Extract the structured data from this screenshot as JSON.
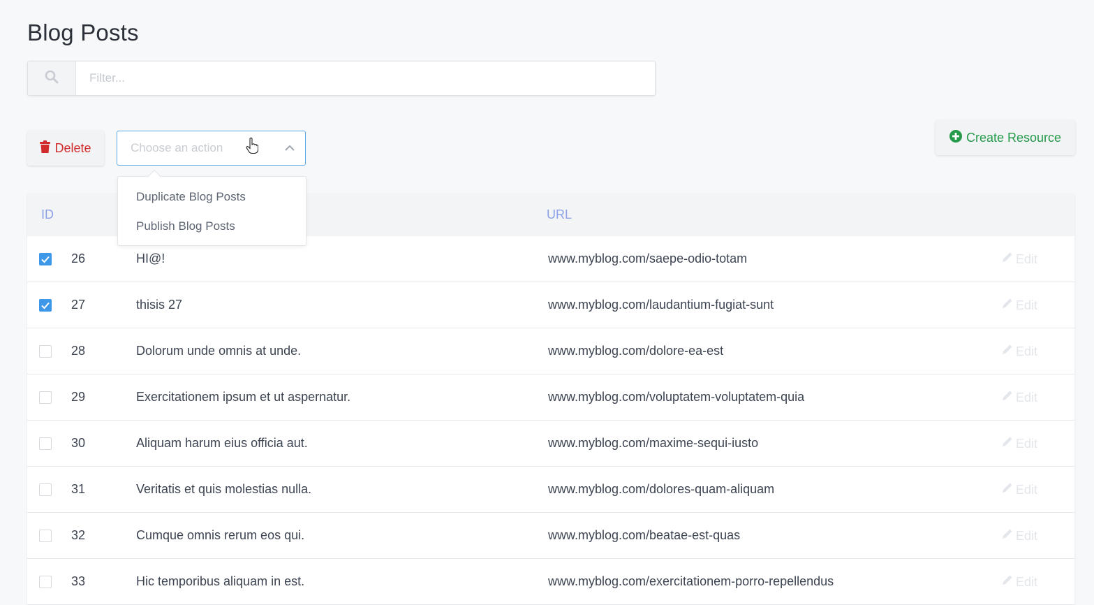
{
  "page": {
    "title": "Blog Posts"
  },
  "filter": {
    "placeholder": "Filter...",
    "value": ""
  },
  "toolbar": {
    "delete_label": "Delete",
    "action_placeholder": "Choose an action",
    "create_label": "Create Resource"
  },
  "action_menu": {
    "open": true,
    "items": [
      {
        "label": "Duplicate Blog Posts"
      },
      {
        "label": "Publish Blog Posts"
      }
    ]
  },
  "table": {
    "columns": {
      "id": "ID",
      "url": "URL"
    },
    "edit_label": "Edit",
    "rows": [
      {
        "checked": true,
        "id": "26",
        "title": "HI@!",
        "url": "www.myblog.com/saepe-odio-totam"
      },
      {
        "checked": true,
        "id": "27",
        "title": "thisis 27",
        "url": "www.myblog.com/laudantium-fugiat-sunt"
      },
      {
        "checked": false,
        "id": "28",
        "title": "Dolorum unde omnis at unde.",
        "url": "www.myblog.com/dolore-ea-est"
      },
      {
        "checked": false,
        "id": "29",
        "title": "Exercitationem ipsum et ut aspernatur.",
        "url": "www.myblog.com/voluptatem-voluptatem-quia"
      },
      {
        "checked": false,
        "id": "30",
        "title": "Aliquam harum eius officia aut.",
        "url": "www.myblog.com/maxime-sequi-iusto"
      },
      {
        "checked": false,
        "id": "31",
        "title": "Veritatis et quis molestias nulla.",
        "url": "www.myblog.com/dolores-quam-aliquam"
      },
      {
        "checked": false,
        "id": "32",
        "title": "Cumque omnis rerum eos qui.",
        "url": "www.myblog.com/beatae-est-quas"
      },
      {
        "checked": false,
        "id": "33",
        "title": "Hic temporibus aliquam in est.",
        "url": "www.myblog.com/exercitationem-porro-repellendus"
      }
    ]
  },
  "colors": {
    "accent": "#3f97e8",
    "danger": "#d12b2b",
    "success": "#259a4a",
    "header_text": "#8da1e6"
  },
  "icons": {
    "filter": "search-icon",
    "delete": "trash-icon",
    "select": "chevron-up-icon",
    "create": "plus-circle-icon",
    "edit": "pencil-icon"
  }
}
